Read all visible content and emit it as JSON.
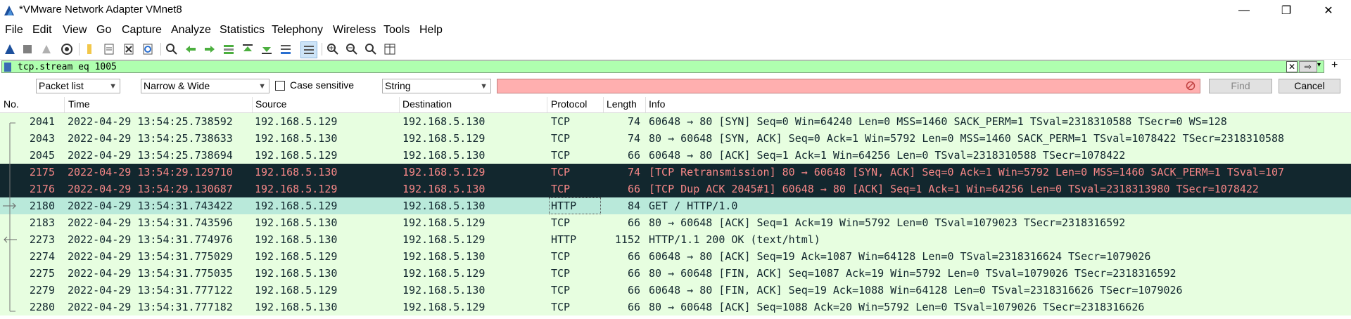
{
  "window": {
    "title": "*VMware Network Adapter VMnet8",
    "minimize": "—",
    "maximize": "❐",
    "close": "✕"
  },
  "menu": [
    "File",
    "Edit",
    "View",
    "Go",
    "Capture",
    "Analyze",
    "Statistics",
    "Telephony",
    "Wireless",
    "Tools",
    "Help"
  ],
  "filter": {
    "value": "tcp.stream eq 1005",
    "bg_color": "#afffaf"
  },
  "find": {
    "search_in": "Packet list",
    "char_width": "Narrow & Wide",
    "case_sensitive_label": "Case sensitive",
    "search_type": "String",
    "find_label": "Find",
    "cancel_label": "Cancel"
  },
  "columns": [
    "No.",
    "Time",
    "Source",
    "Destination",
    "Protocol",
    "Length",
    "Info"
  ],
  "packets": [
    {
      "no": "2041",
      "time": "2022-04-29 13:54:25.738592",
      "src": "192.168.5.129",
      "dst": "192.168.5.130",
      "proto": "TCP",
      "len": "74",
      "info": "60648 → 80 [SYN] Seq=0 Win=64240 Len=0 MSS=1460 SACK_PERM=1 TSval=2318310588 TSecr=0 WS=128",
      "style": "normal"
    },
    {
      "no": "2043",
      "time": "2022-04-29 13:54:25.738633",
      "src": "192.168.5.130",
      "dst": "192.168.5.129",
      "proto": "TCP",
      "len": "74",
      "info": "80 → 60648 [SYN, ACK] Seq=0 Ack=1 Win=5792 Len=0 MSS=1460 SACK_PERM=1 TSval=1078422 TSecr=2318310588",
      "style": "normal"
    },
    {
      "no": "2045",
      "time": "2022-04-29 13:54:25.738694",
      "src": "192.168.5.129",
      "dst": "192.168.5.130",
      "proto": "TCP",
      "len": "66",
      "info": "60648 → 80 [ACK] Seq=1 Ack=1 Win=64256 Len=0 TSval=2318310588 TSecr=1078422",
      "style": "normal"
    },
    {
      "no": "2175",
      "time": "2022-04-29 13:54:29.129710",
      "src": "192.168.5.130",
      "dst": "192.168.5.129",
      "proto": "TCP",
      "len": "74",
      "info": "[TCP Retransmission] 80 → 60648 [SYN, ACK] Seq=0 Ack=1 Win=5792 Len=0 MSS=1460 SACK_PERM=1 TSval=107",
      "style": "bad"
    },
    {
      "no": "2176",
      "time": "2022-04-29 13:54:29.130687",
      "src": "192.168.5.129",
      "dst": "192.168.5.130",
      "proto": "TCP",
      "len": "66",
      "info": "[TCP Dup ACK 2045#1] 60648 → 80 [ACK] Seq=1 Ack=1 Win=64256 Len=0 TSval=2318313980 TSecr=1078422",
      "style": "bad"
    },
    {
      "no": "2180",
      "time": "2022-04-29 13:54:31.743422",
      "src": "192.168.5.129",
      "dst": "192.168.5.130",
      "proto": "HTTP",
      "len": "84",
      "info": "GET / HTTP/1.0",
      "style": "selected"
    },
    {
      "no": "2183",
      "time": "2022-04-29 13:54:31.743596",
      "src": "192.168.5.130",
      "dst": "192.168.5.129",
      "proto": "TCP",
      "len": "66",
      "info": "80 → 60648 [ACK] Seq=1 Ack=19 Win=5792 Len=0 TSval=1079023 TSecr=2318316592",
      "style": "normal"
    },
    {
      "no": "2273",
      "time": "2022-04-29 13:54:31.774976",
      "src": "192.168.5.130",
      "dst": "192.168.5.129",
      "proto": "HTTP",
      "len": "1152",
      "info": "HTTP/1.1 200 OK  (text/html)",
      "style": "normal"
    },
    {
      "no": "2274",
      "time": "2022-04-29 13:54:31.775029",
      "src": "192.168.5.129",
      "dst": "192.168.5.130",
      "proto": "TCP",
      "len": "66",
      "info": "60648 → 80 [ACK] Seq=19 Ack=1087 Win=64128 Len=0 TSval=2318316624 TSecr=1079026",
      "style": "normal"
    },
    {
      "no": "2275",
      "time": "2022-04-29 13:54:31.775035",
      "src": "192.168.5.130",
      "dst": "192.168.5.129",
      "proto": "TCP",
      "len": "66",
      "info": "80 → 60648 [FIN, ACK] Seq=1087 Ack=19 Win=5792 Len=0 TSval=1079026 TSecr=2318316592",
      "style": "normal"
    },
    {
      "no": "2279",
      "time": "2022-04-29 13:54:31.777122",
      "src": "192.168.5.129",
      "dst": "192.168.5.130",
      "proto": "TCP",
      "len": "66",
      "info": "60648 → 80 [FIN, ACK] Seq=19 Ack=1088 Win=64128 Len=0 TSval=2318316626 TSecr=1079026",
      "style": "normal"
    },
    {
      "no": "2280",
      "time": "2022-04-29 13:54:31.777182",
      "src": "192.168.5.130",
      "dst": "192.168.5.129",
      "proto": "TCP",
      "len": "66",
      "info": "80 → 60648 [ACK] Seq=1088 Ack=20 Win=5792 Len=0 TSval=1079026 TSecr=2318316626",
      "style": "normal"
    }
  ],
  "colors": {
    "normal_bg": "#e7fee0",
    "normal_fg": "#12272e",
    "bad_bg": "#12272e",
    "bad_fg": "#f78787",
    "selected_bg": "#b9e9da",
    "selected_fg": "#12272e"
  }
}
